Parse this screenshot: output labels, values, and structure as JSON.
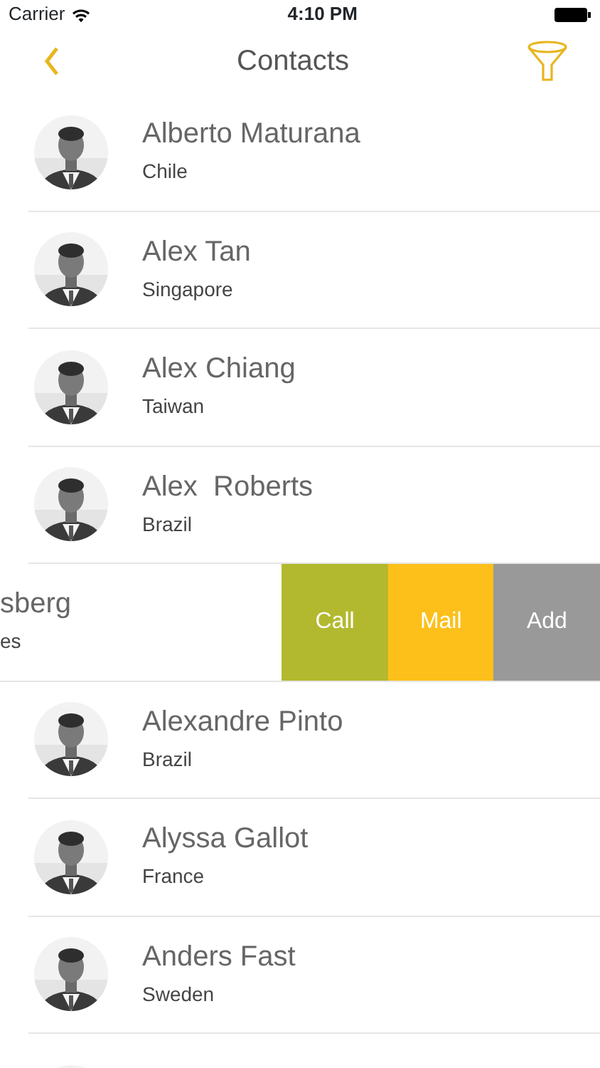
{
  "status_bar": {
    "carrier": "Carrier",
    "time": "4:10 PM"
  },
  "nav": {
    "title": "Contacts"
  },
  "contacts": [
    {
      "kind": "row",
      "name": "Alberto Maturana",
      "country": "Chile"
    },
    {
      "kind": "row",
      "name": "Alex Tan",
      "country": "Singapore"
    },
    {
      "kind": "row",
      "name": "Alex Chiang",
      "country": "Taiwan"
    },
    {
      "kind": "row",
      "name": "Alex  Roberts",
      "country": "Brazil"
    },
    {
      "kind": "swiped",
      "name": "sberg",
      "country": "es",
      "actions": [
        {
          "label": "Call",
          "color": "#b3b92f"
        },
        {
          "label": "Mail",
          "color": "#fdc01a"
        },
        {
          "label": "Add",
          "color": "#999999"
        }
      ]
    },
    {
      "kind": "row",
      "name": "Alexandre Pinto",
      "country": "Brazil"
    },
    {
      "kind": "row",
      "name": "Alyssa Gallot",
      "country": "France"
    },
    {
      "kind": "row",
      "name": "Anders Fast",
      "country": "Sweden"
    },
    {
      "kind": "partial"
    }
  ]
}
